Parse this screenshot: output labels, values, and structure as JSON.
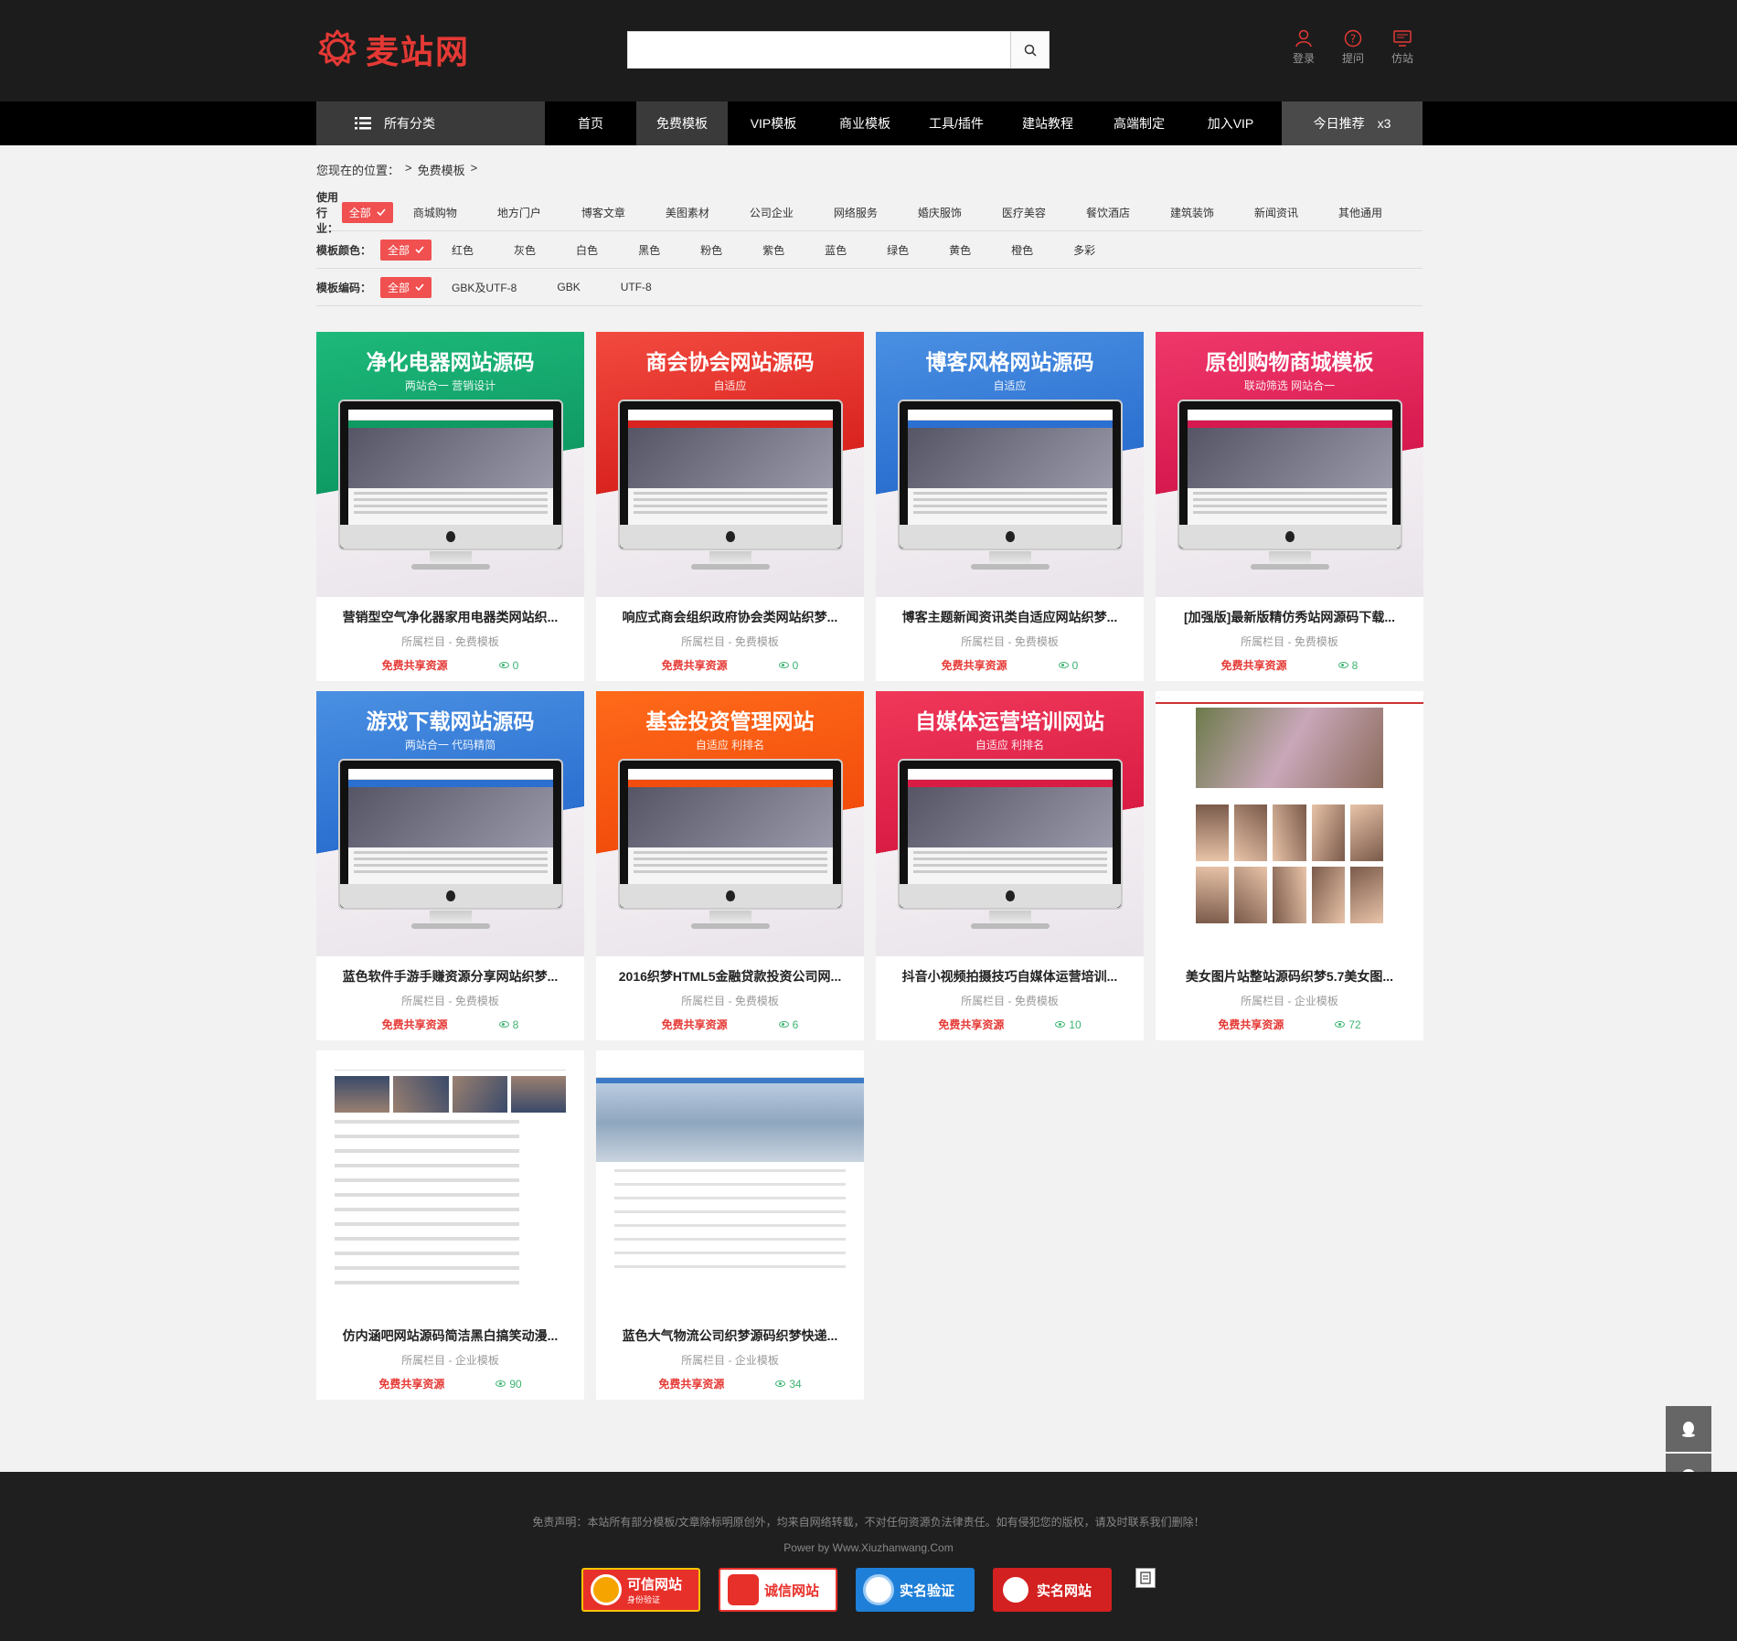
{
  "header": {
    "logo_text": "麦站网",
    "search_placeholder": "",
    "icons": [
      {
        "label": "登录",
        "icon": "user-icon"
      },
      {
        "label": "提问",
        "icon": "question-icon"
      },
      {
        "label": "仿站",
        "icon": "monitor-icon"
      }
    ]
  },
  "nav": {
    "category_label": "所有分类",
    "items": [
      "首页",
      "免费模板",
      "VIP模板",
      "商业模板",
      "工具/插件",
      "建站教程",
      "高端制定",
      "加入VIP"
    ],
    "active_index": 1,
    "today_label": "今日推荐",
    "today_count": "x3"
  },
  "breadcrumb": {
    "prefix": "您现在的位置：",
    "sep": ">",
    "current": "免费模板"
  },
  "filters": [
    {
      "label": "使用行业：",
      "selected": "全部",
      "options": [
        "商城购物",
        "地方门户",
        "博客文章",
        "美图素材",
        "公司企业",
        "网络服务",
        "婚庆服饰",
        "医疗美容",
        "餐饮酒店",
        "建筑装饰",
        "新闻资讯",
        "其他通用"
      ]
    },
    {
      "label": "模板颜色：",
      "selected": "全部",
      "options": [
        "红色",
        "灰色",
        "白色",
        "黑色",
        "粉色",
        "紫色",
        "蓝色",
        "绿色",
        "黄色",
        "橙色",
        "多彩"
      ]
    },
    {
      "label": "模板编码：",
      "selected": "全部",
      "options": [
        "GBK及UTF-8",
        "GBK",
        "UTF-8"
      ]
    }
  ],
  "cards": [
    {
      "thumb_title": "净化电器网站源码",
      "thumb_sub": "两站合一  营销设计",
      "name": "营销型空气净化器家用电器类网站织...",
      "category": "所属栏目 - 免费模板",
      "free": "免费共享资源",
      "views": "0",
      "theme": "green"
    },
    {
      "thumb_title": "商会协会网站源码",
      "thumb_sub": "自适应",
      "name": "响应式商会组织政府协会类网站织梦...",
      "category": "所属栏目 - 免费模板",
      "free": "免费共享资源",
      "views": "0",
      "theme": "red"
    },
    {
      "thumb_title": "博客风格网站源码",
      "thumb_sub": "自适应",
      "name": "博客主题新闻资讯类自适应网站织梦...",
      "category": "所属栏目 - 免费模板",
      "free": "免费共享资源",
      "views": "0",
      "theme": "blue"
    },
    {
      "thumb_title": "原创购物商城模板",
      "thumb_sub": "联动筛选  网站合一",
      "name": "[加强版]最新版精仿秀站网源码下载...",
      "category": "所属栏目 - 免费模板",
      "free": "免费共享资源",
      "views": "8",
      "theme": "pink"
    },
    {
      "thumb_title": "游戏下载网站源码",
      "thumb_sub": "两站合一  代码精简",
      "name": "蓝色软件手游手赚资源分享网站织梦...",
      "category": "所属栏目 - 免费模板",
      "free": "免费共享资源",
      "views": "8",
      "theme": "blue"
    },
    {
      "thumb_title": "基金投资管理网站",
      "thumb_sub": "自适应  利排名",
      "name": "2016织梦HTML5金融贷款投资公司网...",
      "category": "所属栏目 - 免费模板",
      "free": "免费共享资源",
      "views": "6",
      "theme": "orange"
    },
    {
      "thumb_title": "自媒体运营培训网站",
      "thumb_sub": "自适应  利排名",
      "name": "抖音小视频拍摄技巧自媒体运营培训...",
      "category": "所属栏目 - 免费模板",
      "free": "免费共享资源",
      "views": "10",
      "theme": "rose"
    },
    {
      "thumb_title": "",
      "thumb_sub": "",
      "name": "美女图片站整站源码织梦5.7美女图...",
      "category": "所属栏目 - 企业模板",
      "free": "免费共享资源",
      "views": "72",
      "theme": "photo"
    },
    {
      "thumb_title": "",
      "thumb_sub": "",
      "name": "仿内涵吧网站源码简洁黑白搞笑动漫...",
      "category": "所属栏目 - 企业模板",
      "free": "免费共享资源",
      "views": "90",
      "theme": "shot"
    },
    {
      "thumb_title": "",
      "thumb_sub": "",
      "name": "蓝色大气物流公司织梦源码织梦快递...",
      "category": "所属栏目 - 企业模板",
      "free": "免费共享资源",
      "views": "34",
      "theme": "ship"
    }
  ],
  "footer": {
    "disclaimer": "免责声明：本站所有部分模板/文章除标明原创外，均来自网络转载，不对任何资源负法律责任。如有侵犯您的版权，请及时联系我们删除！",
    "power": "Power by Www.Xiuzhanwang.Com",
    "badges": [
      {
        "title": "可信网站",
        "sub": "身份验证"
      },
      {
        "title": "诚信网站",
        "sub": ""
      },
      {
        "title": "实名验证",
        "sub": ""
      },
      {
        "title": "实名网站",
        "sub": ""
      }
    ]
  },
  "colors": {
    "accent": "#e53935",
    "header_bg": "#1c1c1c",
    "nav_bg": "#000000",
    "views": "#3cb371"
  }
}
